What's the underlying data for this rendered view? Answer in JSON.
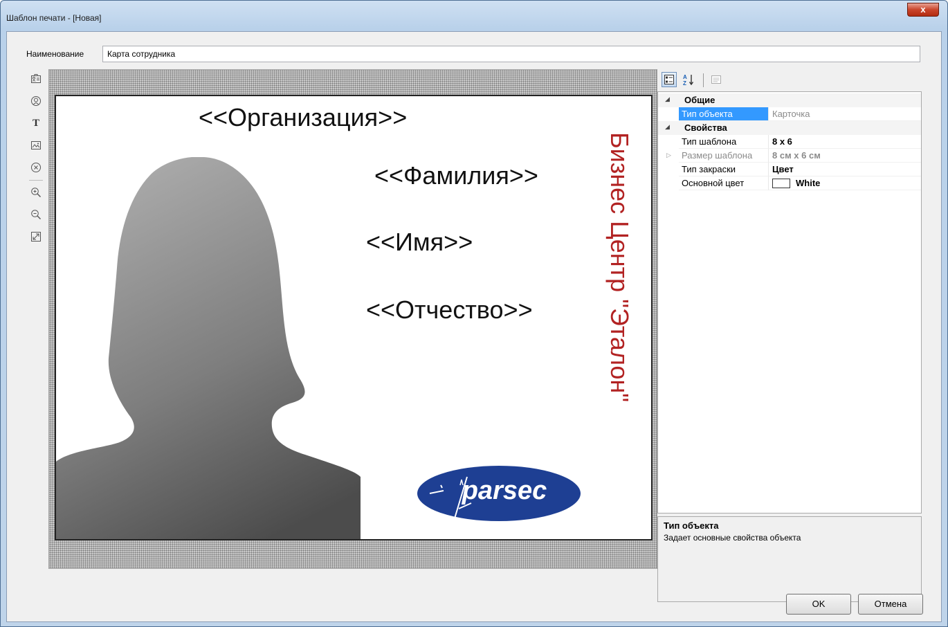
{
  "window": {
    "title": "Шаблон печати - [Новая]",
    "close_label": "x"
  },
  "name_field": {
    "label": "Наименование",
    "value": "Карта сотрудника"
  },
  "toolbar": {
    "icons": [
      "card-icon",
      "portrait-icon",
      "text-icon",
      "image-icon",
      "delete-icon",
      "zoom-in-icon",
      "zoom-out-icon",
      "fit-icon"
    ],
    "text_tool_glyph": "T"
  },
  "card": {
    "organization": "<<Организация>>",
    "last_name": "<<Фамилия>>",
    "first_name": "<<Имя>>",
    "patronymic": "<<Отчество>>",
    "vertical_text": "Бизнес Центр \"Эталон\"",
    "vertical_text_color": "#b22222",
    "logo_text": "parsec",
    "logo_color": "#1e3f93"
  },
  "properties": {
    "categories": [
      {
        "name": "Общие",
        "rows": [
          {
            "name": "Тип объекта",
            "value": "Карточка",
            "selected": true
          }
        ]
      },
      {
        "name": "Свойства",
        "rows": [
          {
            "name": "Тип шаблона",
            "value": "8 x 6"
          },
          {
            "name": "Размер шаблона",
            "value": "8 см x 6 см"
          },
          {
            "name": "Тип закраски",
            "value": "Цвет"
          },
          {
            "name": "Основной цвет",
            "value": "White"
          }
        ]
      }
    ],
    "description_title": "Тип объекта",
    "description_text": "Задает основные свойства объекта"
  },
  "buttons": {
    "ok": "OK",
    "cancel": "Отмена"
  }
}
